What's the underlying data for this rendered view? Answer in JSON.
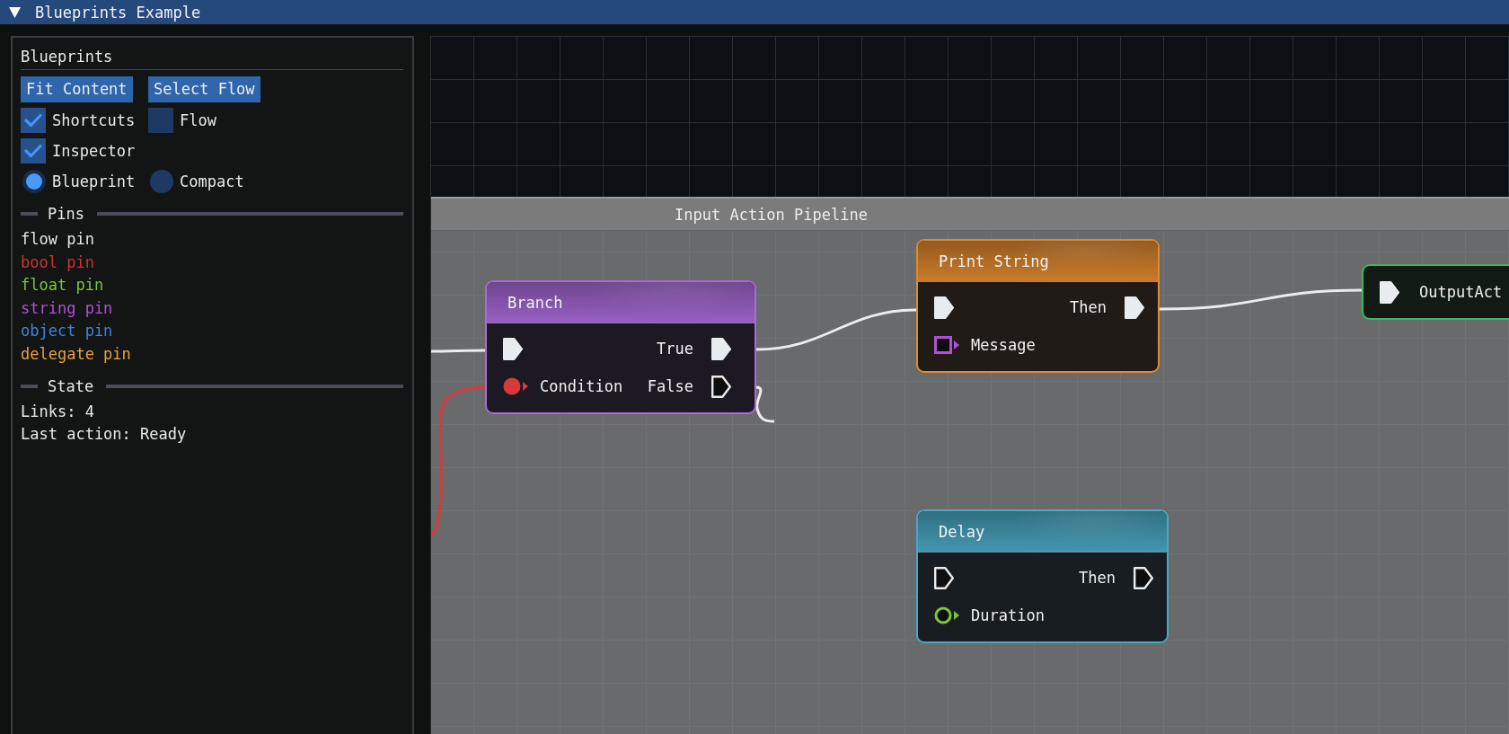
{
  "window": {
    "title": "Blueprints Example",
    "expanded": true
  },
  "sidebar": {
    "title": "Blueprints",
    "buttons": [
      {
        "label": "Fit Content"
      },
      {
        "label": "Select Flow"
      }
    ],
    "checkboxes": [
      {
        "label": "Shortcuts",
        "checked": true
      },
      {
        "label": "Flow",
        "checked": false
      },
      {
        "label": "Inspector",
        "checked": true
      }
    ],
    "view_modes": [
      {
        "label": "Blueprint",
        "selected": true
      },
      {
        "label": "Compact",
        "selected": false
      }
    ],
    "pins_heading": "Pins",
    "pin_legend": [
      {
        "label": "flow pin",
        "color": "#e6e6e6"
      },
      {
        "label": "bool pin",
        "color": "#d23232"
      },
      {
        "label": "float pin",
        "color": "#7cc43a"
      },
      {
        "label": "string pin",
        "color": "#b050d8"
      },
      {
        "label": "object pin",
        "color": "#3a86d8"
      },
      {
        "label": "delegate pin",
        "color": "#e8a33a"
      }
    ],
    "state_heading": "State",
    "state_lines": [
      "Links: 4",
      "Last action: Ready"
    ]
  },
  "canvas": {
    "group": {
      "title": "Input Action Pipeline"
    },
    "nodes": [
      {
        "kind": "full",
        "title": "Branch",
        "color": "#a86ad8",
        "rows": [
          {
            "left": {
              "kind": "flow",
              "color": "#e8ecef",
              "connected": true
            },
            "right": {
              "label": "True",
              "kind": "flow",
              "color": "#e8ecef",
              "connected": true
            }
          },
          {
            "left": {
              "label": "Condition",
              "kind": "bool",
              "color": "#d83a3a",
              "connected": true
            },
            "right": {
              "label": "False",
              "kind": "flow",
              "color": "#e8ecef",
              "connected": false
            }
          }
        ]
      },
      {
        "kind": "full",
        "title": "Print String",
        "color": "#e0892e",
        "rows": [
          {
            "left": {
              "kind": "flow",
              "color": "#e8ecef",
              "connected": true
            },
            "right": {
              "label": "Then",
              "kind": "flow",
              "color": "#e8ecef",
              "connected": true
            }
          },
          {
            "left": {
              "label": "Message",
              "kind": "string",
              "color": "#b050d8",
              "connected": false
            }
          }
        ]
      },
      {
        "kind": "compact",
        "color": "#3cb862",
        "rows": [
          {
            "left": {
              "label": "OutputAct",
              "kind": "flow",
              "color": "#e8ecef",
              "connected": true
            }
          }
        ]
      },
      {
        "kind": "full",
        "title": "Delay",
        "color": "#4aa8c2",
        "rows": [
          {
            "left": {
              "kind": "flow",
              "color": "#e8ecef",
              "connected": false
            },
            "right": {
              "label": "Then",
              "kind": "flow",
              "color": "#e8ecef",
              "connected": false
            }
          },
          {
            "left": {
              "label": "Duration",
              "kind": "float",
              "color": "#7cc43a",
              "connected": false
            }
          }
        ]
      }
    ]
  }
}
